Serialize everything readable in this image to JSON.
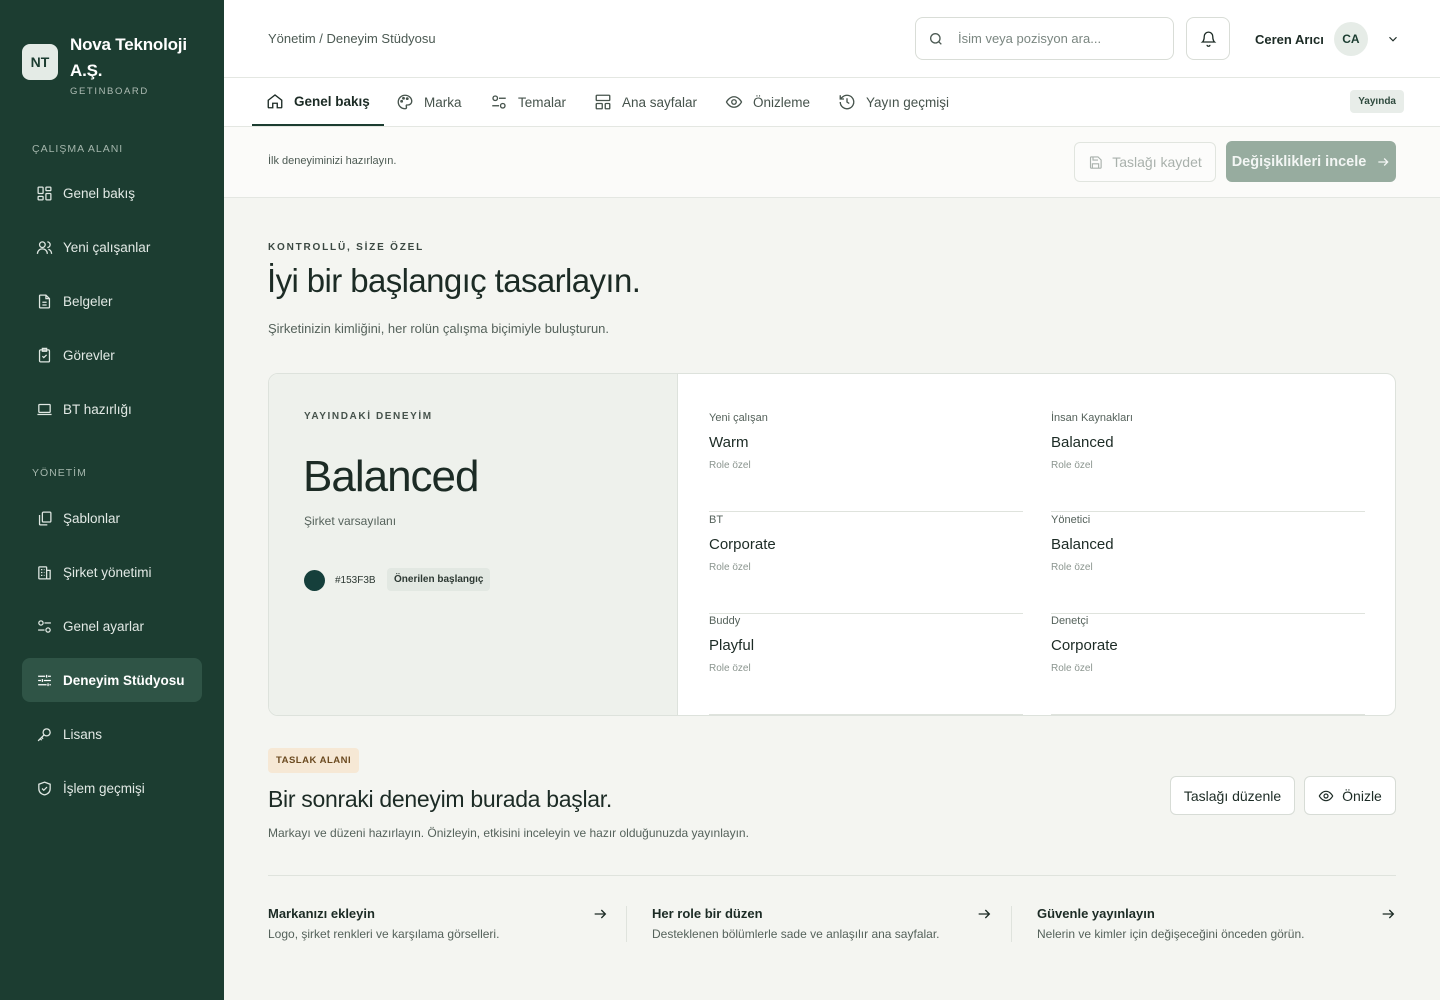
{
  "brand": {
    "initials": "NT",
    "name": "Nova Teknoloji A.Ş.",
    "sub": "GETINBOARD"
  },
  "sidebar": {
    "workspace_label": "ÇALIŞMA ALANI",
    "management_label": "YÖNETİM",
    "items": [
      {
        "label": "Genel bakış",
        "icon": "dashboard-icon"
      },
      {
        "label": "Yeni çalışanlar",
        "icon": "users-icon"
      },
      {
        "label": "Belgeler",
        "icon": "document-icon"
      },
      {
        "label": "Görevler",
        "icon": "clipboard-check-icon"
      },
      {
        "label": "BT hazırlığı",
        "icon": "laptop-icon"
      },
      {
        "label": "Şablonlar",
        "icon": "copy-icon"
      },
      {
        "label": "Şirket yönetimi",
        "icon": "building-icon"
      },
      {
        "label": "Genel ayarlar",
        "icon": "toggles-icon"
      },
      {
        "label": "Deneyim Stüdyosu",
        "icon": "sliders-icon",
        "active": true
      },
      {
        "label": "Lisans",
        "icon": "key-icon"
      },
      {
        "label": "İşlem geçmişi",
        "icon": "shield-check-icon"
      }
    ]
  },
  "topbar": {
    "breadcrumb": "Yönetim / Deneyim Stüdyosu",
    "search_placeholder": "İsim veya pozisyon ara...",
    "user_name": "Ceren Arıcı",
    "user_initials": "CA"
  },
  "tabs": [
    {
      "label": "Genel bakış",
      "icon": "home-icon",
      "active": true
    },
    {
      "label": "Marka",
      "icon": "palette-icon"
    },
    {
      "label": "Temalar",
      "icon": "toggles-icon"
    },
    {
      "label": "Ana sayfalar",
      "icon": "layout-icon"
    },
    {
      "label": "Önizleme",
      "icon": "eye-icon"
    },
    {
      "label": "Yayın geçmişi",
      "icon": "history-icon"
    }
  ],
  "live_badge": "Yayında",
  "actionbar": {
    "hint": "İlk deneyiminizi hazırlayın.",
    "save_label": "Taslağı kaydet",
    "review_label": "Değişiklikleri incele"
  },
  "hero": {
    "eyebrow": "KONTROLLÜ, SİZE ÖZEL",
    "title": "İyi bir başlangıç tasarlayın.",
    "subtitle": "Şirketinizin kimliğini, her rolün çalışma biçimiyle buluşturun."
  },
  "experience": {
    "eyebrow": "YAYINDAKİ DENEYİM",
    "name": "Balanced",
    "description": "Şirket varsayılanı",
    "color_hex": "#153F3B",
    "tag": "Önerilen başlangıç",
    "roles": [
      {
        "label": "Yeni çalışan",
        "value": "Warm",
        "note": "Role özel"
      },
      {
        "label": "İnsan Kaynakları",
        "value": "Balanced",
        "note": "Role özel"
      },
      {
        "label": "BT",
        "value": "Corporate",
        "note": "Role özel"
      },
      {
        "label": "Yönetici",
        "value": "Balanced",
        "note": "Role özel"
      },
      {
        "label": "Buddy",
        "value": "Playful",
        "note": "Role özel"
      },
      {
        "label": "Denetçi",
        "value": "Corporate",
        "note": "Role özel"
      }
    ]
  },
  "draft": {
    "tag": "TASLAK ALANI",
    "title": "Bir sonraki deneyim burada başlar.",
    "subtitle": "Markayı ve düzeni hazırlayın. Önizleyin, etkisini inceleyin ve hazır olduğunuzda yayınlayın.",
    "edit_label": "Taslağı düzenle",
    "preview_label": "Önizle"
  },
  "steps": [
    {
      "title": "Markanızı ekleyin",
      "desc": "Logo, şirket renkleri ve karşılama görselleri."
    },
    {
      "title": "Her role bir düzen",
      "desc": "Desteklenen bölümlerle sade ve anlaşılır ana sayfalar."
    },
    {
      "title": "Güvenle yayınlayın",
      "desc": "Nelerin ve kimler için değişeceğini önceden görün."
    }
  ]
}
